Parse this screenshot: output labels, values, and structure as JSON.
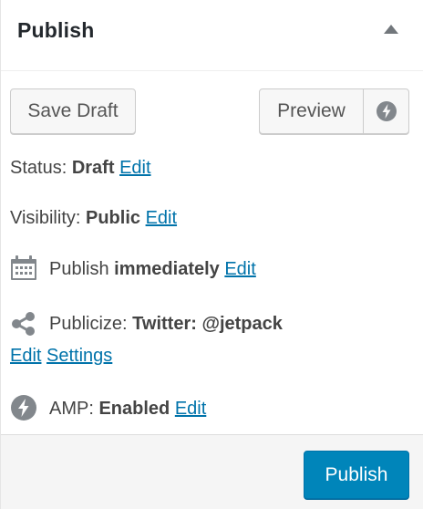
{
  "header": {
    "title": "Publish",
    "toggle_icon": "triangle-up-icon"
  },
  "actions": {
    "save_draft_label": "Save Draft",
    "preview_label": "Preview",
    "amp_icon": "lightning-bolt-icon"
  },
  "status": {
    "label": "Status:",
    "value": "Draft",
    "edit_label": "Edit"
  },
  "visibility": {
    "label": "Visibility:",
    "value": "Public",
    "edit_label": "Edit"
  },
  "schedule": {
    "icon": "calendar-icon",
    "label": "Publish",
    "value": "immediately",
    "edit_label": "Edit"
  },
  "publicize": {
    "icon": "share-icon",
    "label": "Publicize:",
    "value": "Twitter: @jetpack",
    "edit_label": "Edit",
    "settings_label": "Settings"
  },
  "amp": {
    "icon": "lightning-bolt-icon",
    "label": "AMP:",
    "value": "Enabled",
    "edit_label": "Edit"
  },
  "footer": {
    "publish_label": "Publish"
  },
  "colors": {
    "link": "#0073aa",
    "primary": "#0085ba",
    "icon": "#82878c"
  }
}
